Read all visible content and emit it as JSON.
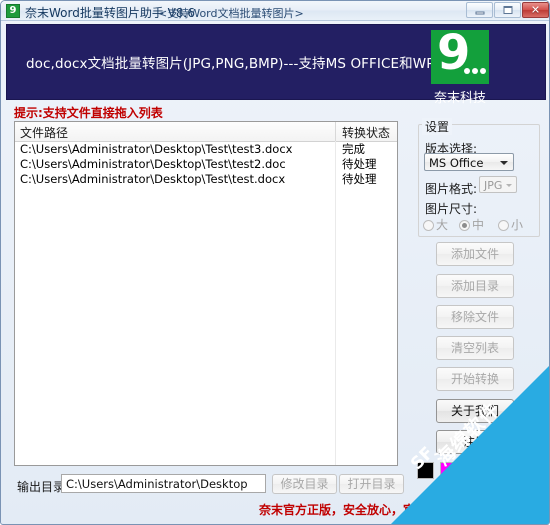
{
  "window": {
    "title": "奈末Word批量转图片助手 V8.6",
    "subtitle": "<支持Word文档批量转图片>",
    "app_icon": "9",
    "controls": {
      "minimize": "minimize-icon",
      "maximize": "maximize-icon",
      "close_glyph": "✕"
    }
  },
  "banner": {
    "headline": "doc,docx文档批量转图片(JPG,PNG,BMP)---支持MS OFFICE和WPS",
    "logo_glyph": "9",
    "logo_label": "奈末科技",
    "background_color": "#231f63",
    "logo_color": "#13a03c"
  },
  "tip": {
    "text": "提示:支持文件直接拖入列表",
    "color": "#c00000"
  },
  "file_list": {
    "columns": [
      "文件路径",
      "转换状态"
    ],
    "rows": [
      {
        "path": "C:\\Users\\Administrator\\Desktop\\Test\\test3.docx",
        "status": "完成"
      },
      {
        "path": "C:\\Users\\Administrator\\Desktop\\Test\\test2.doc",
        "status": "待处理"
      },
      {
        "path": "C:\\Users\\Administrator\\Desktop\\Test\\test.docx",
        "status": "待处理"
      }
    ]
  },
  "settings": {
    "legend": "设置",
    "version_label": "版本选择:",
    "version_value": "MS Office",
    "format_label": "图片格式:",
    "format_value": "JPG",
    "size_label": "图片尺寸:",
    "size_options": [
      {
        "label": "大",
        "selected": false
      },
      {
        "label": "中",
        "selected": true
      },
      {
        "label": "小",
        "selected": false
      }
    ]
  },
  "actions": {
    "add_file": "添加文件",
    "add_dir": "添加目录",
    "remove_file": "移除文件",
    "clear_list": "清空列表",
    "start_convert": "开始转换",
    "about_us": "关于我们",
    "register": "注册"
  },
  "swatches": [
    "#000000",
    "#ff00ff"
  ],
  "bottom": {
    "output_label": "输出目录:",
    "output_value": "C:\\Users\\Administrator\\Desktop",
    "change_dir": "修改目录",
    "open_dir": "打开目录",
    "note": "奈末官方正版，安全放心，官方下载",
    "note_color": "#c00000"
  },
  "watermark": {
    "text": "海绵软件",
    "mark": "SF",
    "color": "#29abe2"
  }
}
